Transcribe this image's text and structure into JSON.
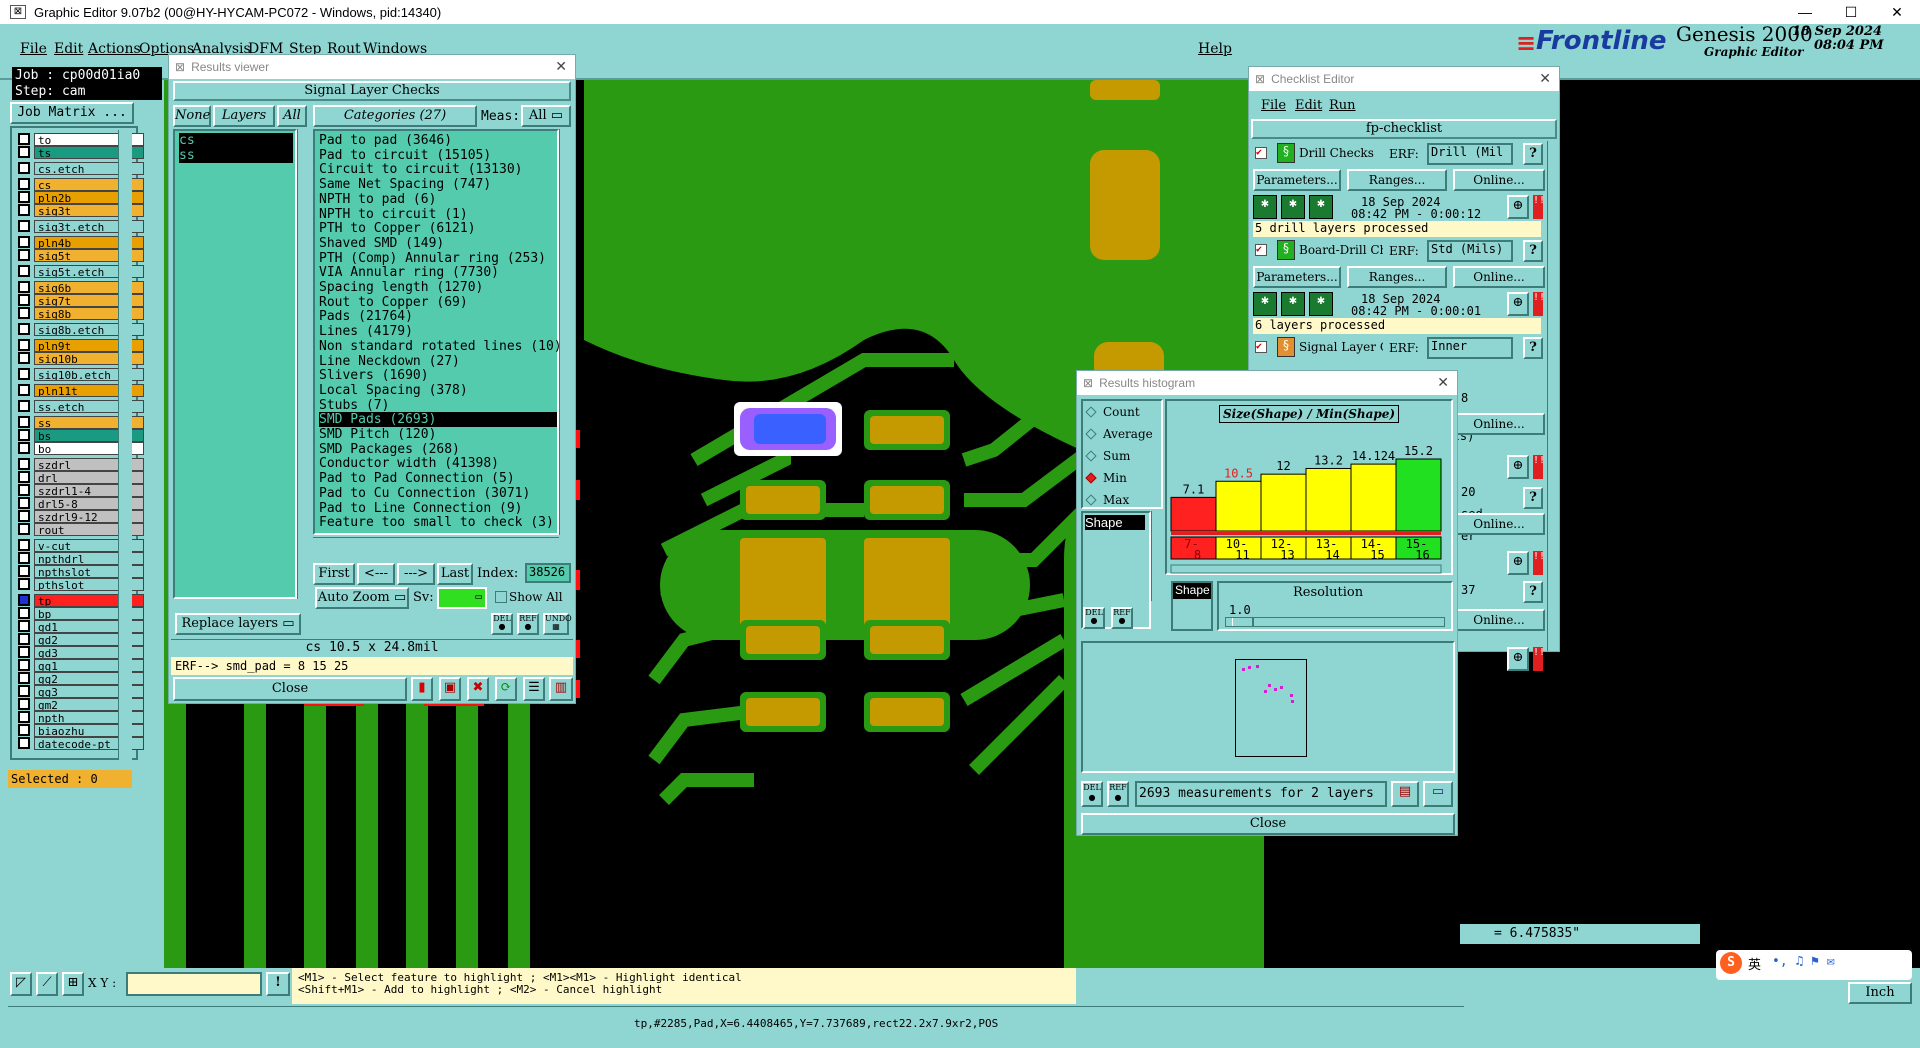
{
  "titlebar": {
    "title": "Graphic Editor 9.07b2 (00@HY-HYCAM-PC072 - Windows, pid:14340)"
  },
  "menubar": {
    "items": [
      "File",
      "Edit",
      "Actions",
      "Options",
      "Analysis",
      "DFM",
      "Step",
      "Rout",
      "Windows"
    ],
    "help": "Help"
  },
  "brand": {
    "logo": "Frontline",
    "product": "Genesis 2000",
    "subtitle": "Graphic Editor",
    "date": "18 Sep 2024",
    "time": "08:04 PM"
  },
  "job": {
    "job_label": "Job : cp00d01ia0",
    "step_label": "Step: cam",
    "matrix_button": "Job Matrix ...",
    "selected": "Selected : 0"
  },
  "layers": [
    {
      "name": "to",
      "bg": "#ffffff"
    },
    {
      "name": "ts",
      "bg": "#1a9a80"
    },
    {
      "name": "cs.etch",
      "bg": "#8fd6d3"
    },
    {
      "name": "cs",
      "bg": "#f0b030"
    },
    {
      "name": "pln2b",
      "bg": "#e8a000"
    },
    {
      "name": "sig3t",
      "bg": "#f0b030"
    },
    {
      "name": "sig3t.etch",
      "bg": "#8fd6d3"
    },
    {
      "name": "pln4b",
      "bg": "#e8a000"
    },
    {
      "name": "sig5t",
      "bg": "#f0b030"
    },
    {
      "name": "sig5t.etch",
      "bg": "#8fd6d3"
    },
    {
      "name": "sig6b",
      "bg": "#f0b030"
    },
    {
      "name": "sig7t",
      "bg": "#f0b030"
    },
    {
      "name": "sig8b",
      "bg": "#f0b030"
    },
    {
      "name": "sig8b.etch",
      "bg": "#8fd6d3"
    },
    {
      "name": "pln9t",
      "bg": "#e8a000"
    },
    {
      "name": "sig10b",
      "bg": "#f0b030"
    },
    {
      "name": "sig10b.etch",
      "bg": "#8fd6d3"
    },
    {
      "name": "pln11t",
      "bg": "#e8a000"
    },
    {
      "name": "ss.etch",
      "bg": "#8fd6d3"
    },
    {
      "name": "ss",
      "bg": "#f0b030"
    },
    {
      "name": "bs",
      "bg": "#1a9a80"
    },
    {
      "name": "bo",
      "bg": "#ffffff"
    },
    {
      "name": "szdrl",
      "bg": "#c0c0c0"
    },
    {
      "name": "drl",
      "bg": "#c0c0c0"
    },
    {
      "name": "szdrl1-4",
      "bg": "#c0c0c0"
    },
    {
      "name": "drl5-8",
      "bg": "#c0c0c0"
    },
    {
      "name": "szdrl9-12",
      "bg": "#c0c0c0"
    },
    {
      "name": "rout",
      "bg": "#c0c0c0"
    },
    {
      "name": "v-cut",
      "bg": "#8fd6d3"
    },
    {
      "name": "npthdrl",
      "bg": "#8fd6d3"
    },
    {
      "name": "npthslot",
      "bg": "#8fd6d3"
    },
    {
      "name": "pthslot",
      "bg": "#8fd6d3"
    },
    {
      "name": "tp",
      "bg": "#ff2020"
    },
    {
      "name": "bp",
      "bg": "#8fd6d3"
    },
    {
      "name": "gd1",
      "bg": "#8fd6d3"
    },
    {
      "name": "gd2",
      "bg": "#8fd6d3"
    },
    {
      "name": "gd3",
      "bg": "#8fd6d3"
    },
    {
      "name": "gg1",
      "bg": "#8fd6d3"
    },
    {
      "name": "gg2",
      "bg": "#8fd6d3"
    },
    {
      "name": "gg3",
      "bg": "#8fd6d3"
    },
    {
      "name": "gm2",
      "bg": "#8fd6d3"
    },
    {
      "name": "npth",
      "bg": "#8fd6d3"
    },
    {
      "name": "biaozhu",
      "bg": "#8fd6d3"
    },
    {
      "name": "datecode-pt",
      "bg": "#8fd6d3"
    }
  ],
  "results_viewer": {
    "title": "Results viewer",
    "heading": "Signal Layer Checks",
    "none_btn": "None",
    "layers_btn": "Layers",
    "all_btn": "All",
    "layer_items": [
      "cs",
      "ss"
    ],
    "categories_btn": "Categories (27)",
    "meas_label": "Meas:",
    "meas_value": "All",
    "categories": [
      "Pad to pad (3646)",
      "Pad to circuit (15105)",
      "Circuit to circuit (13130)",
      "Same Net Spacing (747)",
      "NPTH to pad (6)",
      "NPTH to circuit (1)",
      "PTH to Copper (6121)",
      "Shaved SMD (149)",
      "PTH (Comp) Annular ring (253)",
      "VIA Annular ring (7730)",
      "Spacing length (1270)",
      "Rout to Copper (69)",
      "Pads (21764)",
      "Lines (4179)",
      "Non standard rotated lines (10)",
      "Line Neckdown (27)",
      "Slivers (1690)",
      "Local Spacing (378)",
      "Stubs (7)",
      "SMD Pads (2693)",
      "SMD Pitch (120)",
      "SMD Packages (268)",
      "Conductor width (41398)",
      "Pad to Pad Connection (5)",
      "Pad to Cu Connection (3071)",
      "Pad to Line Connection (9)",
      "Feature too small to check (3)"
    ],
    "selected_index": 19,
    "nav": {
      "first": "First",
      "prev": "<---",
      "next": "--->",
      "last": "Last",
      "index_label": "Index:",
      "index_value": "38526"
    },
    "auto_zoom": "Auto Zoom",
    "sv_label": "Sv:",
    "show_all": "Show All",
    "replace_layers": "Replace layers",
    "info_line": "cs 10.5 x 24.8mil",
    "erf_line": "ERF--> smd_pad = 8 15 25",
    "close": "Close"
  },
  "checklist": {
    "title": "Checklist Editor",
    "menu": [
      "File",
      "Edit",
      "Run"
    ],
    "name": "fp-checklist",
    "erf_label": "ERF:",
    "params": "Parameters...",
    "ranges": "Ranges...",
    "online": "Online...",
    "checks": [
      {
        "name": "Drill Checks",
        "erf": "Drill (Mil",
        "date": "18 Sep 2024",
        "time": "08:42 PM - 0:00:12",
        "status": "5 drill layers processed"
      },
      {
        "name": "Board-Drill Che",
        "erf": "Std (Mils)",
        "date": "18 Sep 2024",
        "time": "08:42 PM - 0:00:01",
        "status": "6 layers processed"
      },
      {
        "name": "Signal Layer Ch",
        "erf": "Inner"
      }
    ],
    "partial": [
      "8",
      "(Mils)",
      "20",
      "sed",
      "er",
      "37"
    ]
  },
  "histogram": {
    "title": "Results histogram",
    "options": [
      "Count",
      "Average",
      "Sum",
      "Min",
      "Max"
    ],
    "selected_option": "Min",
    "chart_title": "Size(Shape) / Min(Shape)",
    "shape_item": "Shape",
    "shape_label": "Shape",
    "resolution_label": "Resolution",
    "resolution_value": "1.0",
    "measurements": "2693 measurements for 2 layers",
    "close": "Close"
  },
  "chart_data": {
    "type": "bar",
    "title": "Size(Shape) / Min(Shape)",
    "categories": [
      "7-8",
      "10-11",
      "12-13",
      "13-14",
      "14-15",
      "15-16"
    ],
    "values": [
      7.1,
      10.5,
      12,
      13.2,
      14.124,
      15.2
    ],
    "value_labels": [
      "7.1",
      "10.5",
      "12",
      "13.2",
      "14.124",
      "15.2"
    ],
    "colors": [
      "#ff2020",
      "#ffff00",
      "#ffff00",
      "#ffff00",
      "#ffff00",
      "#20e020"
    ]
  },
  "bottom": {
    "xy_label": "X Y :",
    "hint1": "<M1> - Select feature to highlight ; <M1><M1> - Highlight identical",
    "hint2": "<Shift+M1> - Add to highlight ; <M2> - Cancel highlight",
    "status": "tp,#2285,Pad,X=6.4408465,Y=7.737689,rect22.2x7.9xr2,POS",
    "coord": "= 6.475835\"",
    "units": "Inch",
    "ime": "英"
  },
  "colors": {
    "panel": "#8fd6d3",
    "green_copper": "#2a9a12",
    "pad": "#c49a00",
    "highlight": "#4060ff"
  }
}
